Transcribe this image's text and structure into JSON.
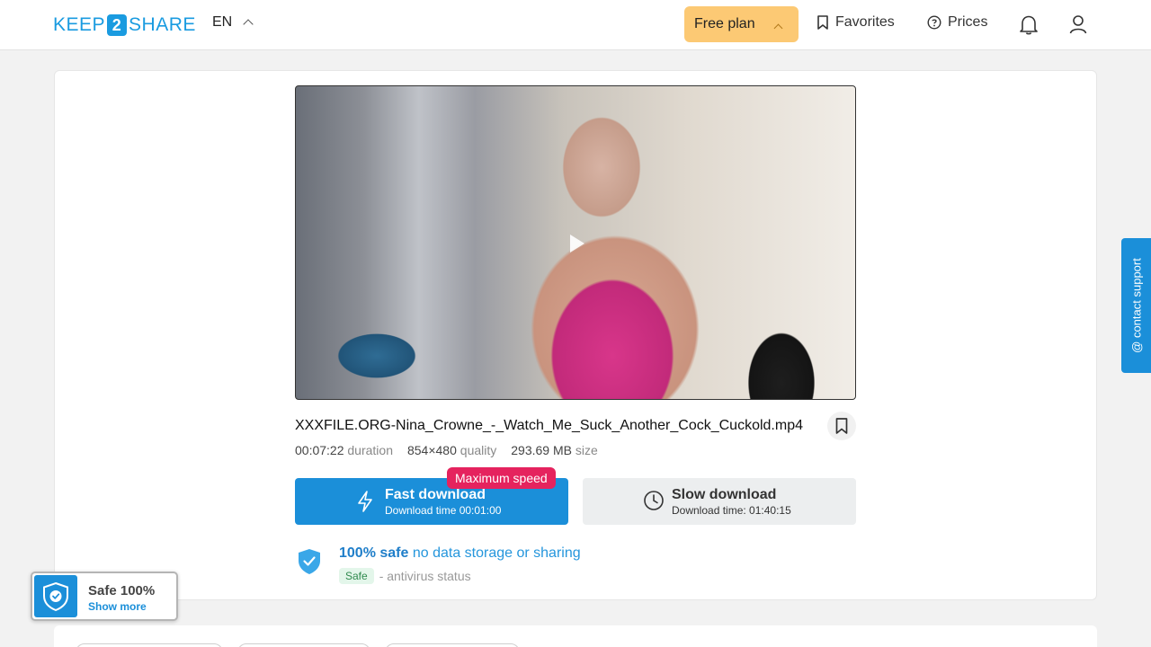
{
  "header": {
    "logo_left": "KEEP",
    "logo_mid": "2",
    "logo_right": "SHARE",
    "lang": "EN",
    "plan": "Free plan",
    "favorites": "Favorites",
    "prices": "Prices"
  },
  "file": {
    "name": "XXXFILE.ORG-Nina_Crowne_-_Watch_Me_Suck_Another_Cock_Cuckold.mp4",
    "duration_value": "00:07:22",
    "duration_label": "duration",
    "quality_value": "854×480",
    "quality_label": "quality",
    "size_value": "293.69 MB",
    "size_label": "size"
  },
  "downloads": {
    "badge": "Maximum speed",
    "fast_label": "Fast download",
    "fast_sub": "Download time 00:01:00",
    "slow_label": "Slow download",
    "slow_sub": "Download time: 01:40:15"
  },
  "safety": {
    "bold": "100% safe",
    "rest": " no data storage or sharing",
    "tag": "Safe",
    "status": "- antivirus status"
  },
  "support": {
    "label": "@ contact support"
  },
  "widget": {
    "title": "Safe 100%",
    "link": "Show more"
  },
  "colors": {
    "accent": "#1b8fd9",
    "plan": "#fcc974",
    "badge": "#e5235e"
  }
}
